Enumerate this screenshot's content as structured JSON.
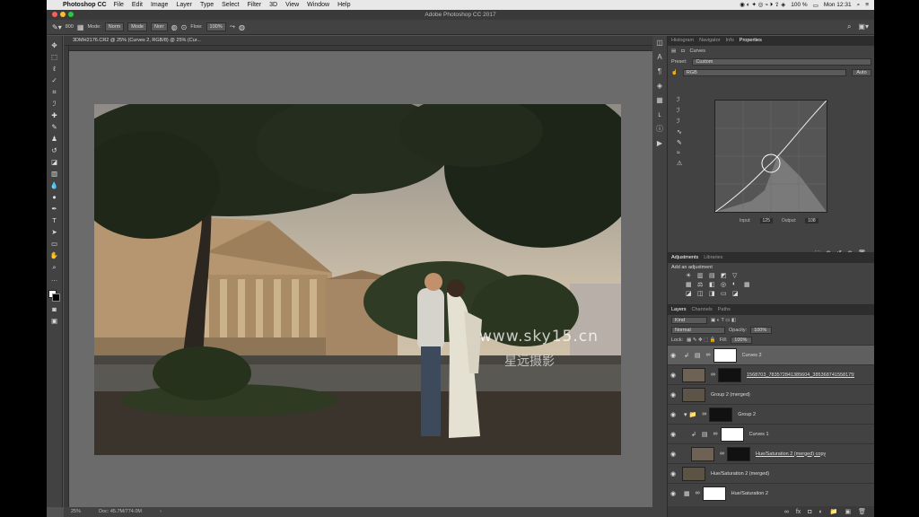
{
  "menubar": {
    "app_name": "Photoshop CC",
    "items": [
      "File",
      "Edit",
      "Image",
      "Layer",
      "Type",
      "Select",
      "Filter",
      "3D",
      "View",
      "Window",
      "Help"
    ],
    "battery": "100 %",
    "clock": "Mon 12:31"
  },
  "titlebar": {
    "title": "Adobe Photoshop CC 2017"
  },
  "options": {
    "brush_size": "800",
    "mode_label": "Mode:",
    "mode_value": "Norm",
    "mode2": "Mode",
    "mode3": "Norr",
    "flow_label": "Flow:",
    "flow_value": "100%"
  },
  "document": {
    "tab_title": "3DMH2176.CR2 @ 25% (Curves 2, RGB/8) @ 25% (Cur...",
    "zoom": "25%",
    "doc_size": "Doc: 45.7M/774.0M",
    "watermark_url": "www.sky15.cn",
    "watermark_cn": "星远摄影"
  },
  "properties": {
    "tabs": [
      "Histogram",
      "Navigator",
      "Info",
      "Properties"
    ],
    "panel_title": "Curves",
    "preset_label": "Preset:",
    "preset_value": "Custom",
    "channel_value": "RGB",
    "auto_label": "Auto",
    "input_label": "Input:",
    "input_value": "125",
    "output_label": "Output:",
    "output_value": "108"
  },
  "adjustments": {
    "tabs": [
      "Adjustments",
      "Libraries"
    ],
    "add_label": "Add an adjustment"
  },
  "layers": {
    "tabs": [
      "Layers",
      "Channels",
      "Paths"
    ],
    "kind_label": "Kind",
    "blend_mode": "Normal",
    "opacity_label": "Opacity:",
    "opacity_value": "100%",
    "lock_label": "Lock:",
    "fill_label": "Fill:",
    "fill_value": "100%",
    "items": [
      {
        "name": "Curves 2"
      },
      {
        "name": "1568703_783572841385604_3853687415581759616_o"
      },
      {
        "name": "Group 2 (merged)"
      },
      {
        "name": "Group 2"
      },
      {
        "name": "Curves 1"
      },
      {
        "name": "Hue/Saturation 2 (merged) copy"
      },
      {
        "name": "Hue/Saturation 2 (merged)"
      },
      {
        "name": "Hue/Saturation 2"
      }
    ]
  }
}
